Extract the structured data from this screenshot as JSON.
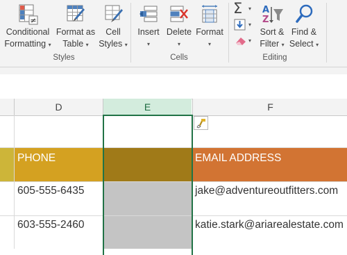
{
  "ribbon": {
    "styles": {
      "group_label": "Styles",
      "conditional_formatting": [
        "Conditional",
        "Formatting"
      ],
      "format_as_table": [
        "Format as",
        "Table"
      ],
      "cell_styles": [
        "Cell",
        "Styles"
      ]
    },
    "cells": {
      "group_label": "Cells",
      "insert": "Insert",
      "delete": "Delete",
      "format": "Format"
    },
    "editing": {
      "group_label": "Editing",
      "sort_filter": [
        "Sort &",
        "Filter"
      ],
      "find_select": [
        "Find &",
        "Select"
      ]
    },
    "caret": "▾"
  },
  "sheet": {
    "columns": [
      "D",
      "E",
      "F"
    ],
    "selected_column": "E",
    "header_row": {
      "phone": "PHONE",
      "email": "EMAIL ADDRESS"
    },
    "rows": [
      {
        "phone": "605-555-6435",
        "email": "jake@adventureoutfitters.com"
      },
      {
        "phone": "603-555-2460",
        "email": "katie.stark@ariarealestate.com"
      }
    ]
  },
  "colors": {
    "phone_header_fill": "#d4a121",
    "selected_header_fill": "#a07a18",
    "email_header_fill": "#d27433",
    "selected_cells_fill": "#c4c4c4",
    "selection_border": "#217346",
    "selected_column_header": "#d3ecdd"
  }
}
